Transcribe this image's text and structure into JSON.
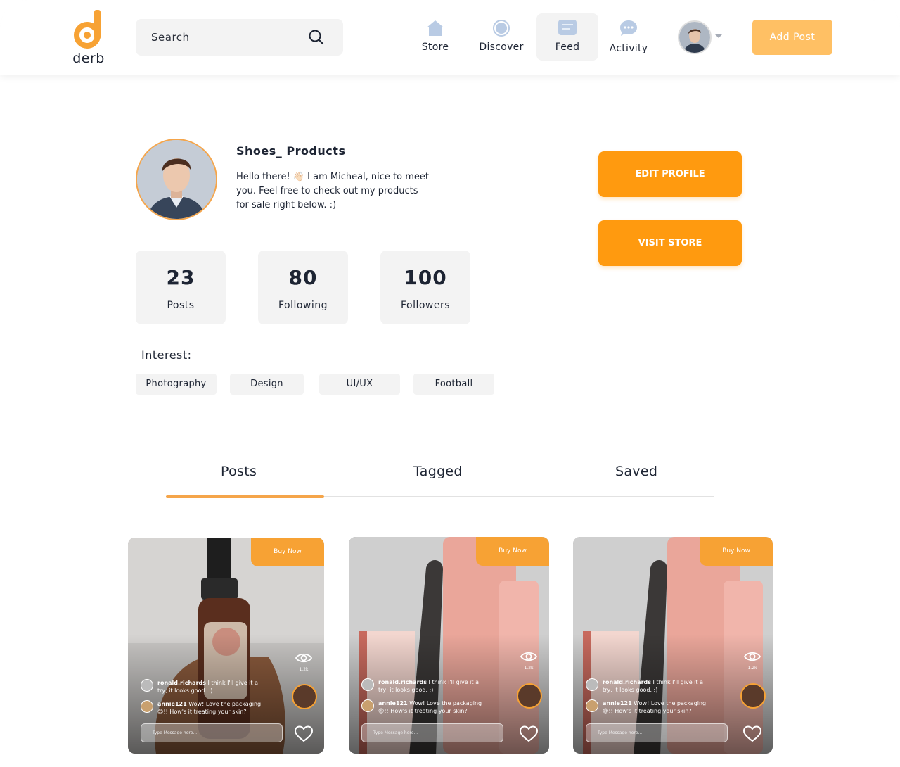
{
  "brand": {
    "name": "derb",
    "accent": "#ff9a0f"
  },
  "search": {
    "placeholder": "Search"
  },
  "nav": {
    "store": "Store",
    "discover": "Discover",
    "feed": "Feed",
    "activity": "Activity"
  },
  "header": {
    "add_post": "Add Post"
  },
  "profile": {
    "username": "Shoes_ Products",
    "bio": "Hello there! 👋🏻 I am Micheal, nice to meet you. Feel free to check out my products for sale right below. :)",
    "edit_label": "EDIT PROFILE",
    "store_label": "VISIT STORE"
  },
  "stats": [
    {
      "value": "23",
      "label": "Posts"
    },
    {
      "value": "80",
      "label": "Following"
    },
    {
      "value": "100",
      "label": "Followers"
    }
  ],
  "interests": {
    "title": "Interest:",
    "items": [
      "Photography",
      "Design",
      "UI/UX",
      "Football"
    ]
  },
  "tabs": [
    "Posts",
    "Tagged",
    "Saved"
  ],
  "cards": [
    {
      "buy": "Buy Now",
      "views": "1.2k",
      "comments": [
        {
          "user": "ronald.richards",
          "text": "I think I'll give it a try, it looks good. :)"
        },
        {
          "user": "annie121",
          "text": "Wow! Love the packaging 😍!! How's it treating your skin?"
        }
      ],
      "input_placeholder": "Type Message here..."
    },
    {
      "buy": "Buy Now",
      "views": "1.2k",
      "comments": [
        {
          "user": "ronald.richards",
          "text": "I think I'll give it a try, it looks good. :)"
        },
        {
          "user": "annie121",
          "text": "Wow! Love the packaging 😍!! How's it treating your skin?"
        }
      ],
      "input_placeholder": "Type Message here..."
    },
    {
      "buy": "Buy Now",
      "views": "1.2k",
      "comments": [
        {
          "user": "ronald.richards",
          "text": "I think I'll give it a try, it looks good. :)"
        },
        {
          "user": "annie121",
          "text": "Wow! Love the packaging 😍!! How's it treating your skin?"
        }
      ],
      "input_placeholder": "Type Message here..."
    }
  ]
}
